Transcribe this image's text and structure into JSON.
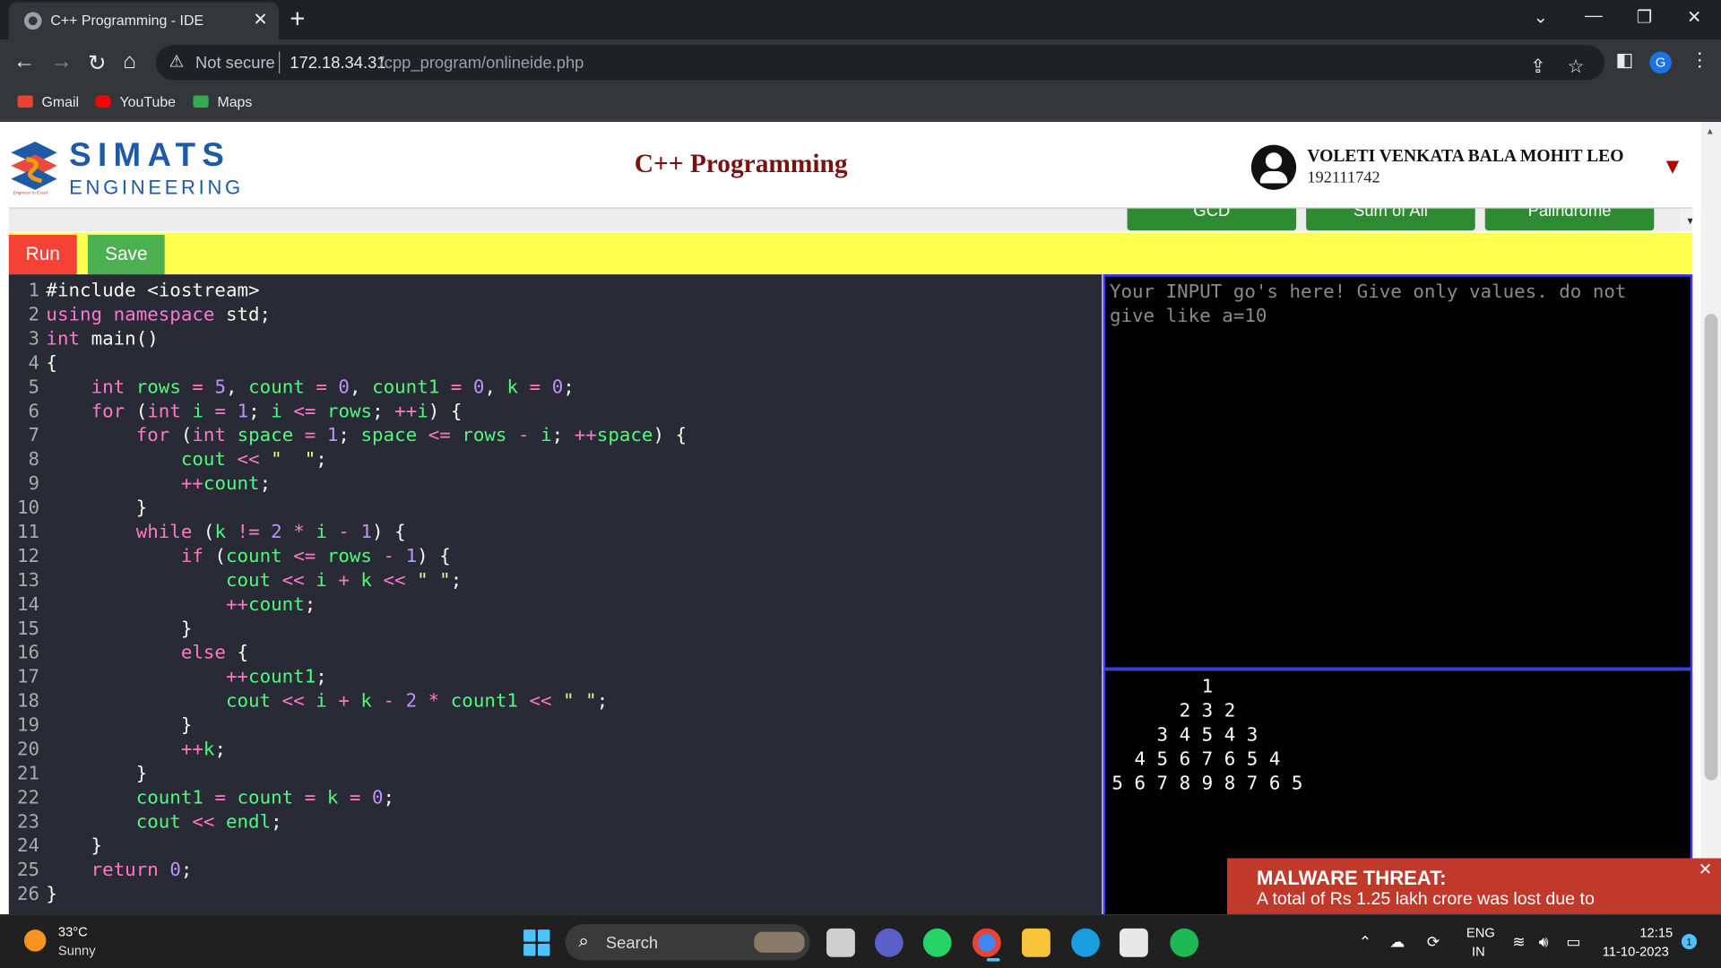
{
  "browser": {
    "tab_title": "C++ Programming - IDE",
    "tab_close": "✕",
    "new_tab": "+",
    "address": {
      "security_label": "Not secure",
      "url_host": "172.18.34.31",
      "url_path": "/cpp_program/onlineide.php"
    },
    "profile_initial": "G",
    "bookmarks": [
      {
        "label": "Gmail",
        "icon": "gmail-icon",
        "color": "#ea4335"
      },
      {
        "label": "YouTube",
        "icon": "youtube-icon",
        "color": "#ff0000"
      },
      {
        "label": "Maps",
        "icon": "maps-icon",
        "color": "#34a853"
      }
    ]
  },
  "header": {
    "logo_main": "SIMATS",
    "logo_sub": "ENGINEERING",
    "logo_tagline": "Engineer to Excel",
    "page_title": "C++ Programming",
    "user_name": "VOLETI VENKATA BALA MOHIT LEO",
    "user_id": "192111742"
  },
  "examples": [
    "GCD",
    "Sum of All",
    "Palindrome"
  ],
  "actions": {
    "run_label": "Run",
    "save_label": "Save"
  },
  "editor": {
    "lines": [
      {
        "n": "1",
        "tokens": [
          [
            "t",
            "#include <iostream>"
          ]
        ]
      },
      {
        "n": "2",
        "tokens": [
          [
            "kw",
            "using namespace"
          ],
          [
            "t",
            " std;"
          ]
        ]
      },
      {
        "n": "3",
        "tokens": [
          [
            "ty",
            "int"
          ],
          [
            "t",
            " main()"
          ]
        ]
      },
      {
        "n": "4",
        "tokens": [
          [
            "t",
            "{"
          ]
        ]
      },
      {
        "n": "5",
        "tokens": [
          [
            "t",
            "    "
          ],
          [
            "ty",
            "int"
          ],
          [
            "t",
            " "
          ],
          [
            "id",
            "rows"
          ],
          [
            "op",
            " = "
          ],
          [
            "num",
            "5"
          ],
          [
            "t",
            ", "
          ],
          [
            "id",
            "count"
          ],
          [
            "op",
            " = "
          ],
          [
            "num",
            "0"
          ],
          [
            "t",
            ", "
          ],
          [
            "id",
            "count1"
          ],
          [
            "op",
            " = "
          ],
          [
            "num",
            "0"
          ],
          [
            "t",
            ", "
          ],
          [
            "id",
            "k"
          ],
          [
            "op",
            " = "
          ],
          [
            "num",
            "0"
          ],
          [
            "t",
            ";"
          ]
        ]
      },
      {
        "n": "6",
        "tokens": [
          [
            "t",
            "    "
          ],
          [
            "kw",
            "for"
          ],
          [
            "t",
            " ("
          ],
          [
            "ty",
            "int"
          ],
          [
            "t",
            " "
          ],
          [
            "id",
            "i"
          ],
          [
            "op",
            " = "
          ],
          [
            "num",
            "1"
          ],
          [
            "t",
            "; "
          ],
          [
            "id",
            "i"
          ],
          [
            "op",
            " <= "
          ],
          [
            "id",
            "rows"
          ],
          [
            "t",
            "; "
          ],
          [
            "op",
            "++"
          ],
          [
            "id",
            "i"
          ],
          [
            "t",
            ") {"
          ]
        ]
      },
      {
        "n": "7",
        "tokens": [
          [
            "t",
            "        "
          ],
          [
            "kw",
            "for"
          ],
          [
            "t",
            " ("
          ],
          [
            "ty",
            "int"
          ],
          [
            "t",
            " "
          ],
          [
            "id",
            "space"
          ],
          [
            "op",
            " = "
          ],
          [
            "num",
            "1"
          ],
          [
            "t",
            "; "
          ],
          [
            "id",
            "space"
          ],
          [
            "op",
            " <= "
          ],
          [
            "id",
            "rows"
          ],
          [
            "op",
            " - "
          ],
          [
            "id",
            "i"
          ],
          [
            "t",
            "; "
          ],
          [
            "op",
            "++"
          ],
          [
            "id",
            "space"
          ],
          [
            "t",
            ") {"
          ]
        ]
      },
      {
        "n": "8",
        "tokens": [
          [
            "t",
            "            "
          ],
          [
            "id",
            "cout"
          ],
          [
            "op",
            " << "
          ],
          [
            "str",
            "\"  \""
          ],
          [
            "t",
            ";"
          ]
        ]
      },
      {
        "n": "9",
        "tokens": [
          [
            "t",
            "            "
          ],
          [
            "op",
            "++"
          ],
          [
            "id",
            "count"
          ],
          [
            "t",
            ";"
          ]
        ]
      },
      {
        "n": "10",
        "tokens": [
          [
            "t",
            "        }"
          ]
        ]
      },
      {
        "n": "11",
        "tokens": [
          [
            "t",
            "        "
          ],
          [
            "kw",
            "while"
          ],
          [
            "t",
            " ("
          ],
          [
            "id",
            "k"
          ],
          [
            "op",
            " != "
          ],
          [
            "num",
            "2"
          ],
          [
            "op",
            " * "
          ],
          [
            "id",
            "i"
          ],
          [
            "op",
            " - "
          ],
          [
            "num",
            "1"
          ],
          [
            "t",
            ") {"
          ]
        ]
      },
      {
        "n": "12",
        "tokens": [
          [
            "t",
            "            "
          ],
          [
            "kw",
            "if"
          ],
          [
            "t",
            " ("
          ],
          [
            "id",
            "count"
          ],
          [
            "op",
            " <= "
          ],
          [
            "id",
            "rows"
          ],
          [
            "op",
            " - "
          ],
          [
            "num",
            "1"
          ],
          [
            "t",
            ") {"
          ]
        ]
      },
      {
        "n": "13",
        "tokens": [
          [
            "t",
            "                "
          ],
          [
            "id",
            "cout"
          ],
          [
            "op",
            " << "
          ],
          [
            "id",
            "i"
          ],
          [
            "op",
            " + "
          ],
          [
            "id",
            "k"
          ],
          [
            "op",
            " << "
          ],
          [
            "str",
            "\" \""
          ],
          [
            "t",
            ";"
          ]
        ]
      },
      {
        "n": "14",
        "tokens": [
          [
            "t",
            "                "
          ],
          [
            "op",
            "++"
          ],
          [
            "id",
            "count"
          ],
          [
            "t",
            ";"
          ]
        ]
      },
      {
        "n": "15",
        "tokens": [
          [
            "t",
            "            }"
          ]
        ]
      },
      {
        "n": "16",
        "tokens": [
          [
            "t",
            "            "
          ],
          [
            "kw",
            "else"
          ],
          [
            "t",
            " {"
          ]
        ]
      },
      {
        "n": "17",
        "tokens": [
          [
            "t",
            "                "
          ],
          [
            "op",
            "++"
          ],
          [
            "id",
            "count1"
          ],
          [
            "t",
            ";"
          ]
        ]
      },
      {
        "n": "18",
        "tokens": [
          [
            "t",
            "                "
          ],
          [
            "id",
            "cout"
          ],
          [
            "op",
            " << "
          ],
          [
            "id",
            "i"
          ],
          [
            "op",
            " + "
          ],
          [
            "id",
            "k"
          ],
          [
            "op",
            " - "
          ],
          [
            "num",
            "2"
          ],
          [
            "op",
            " * "
          ],
          [
            "id",
            "count1"
          ],
          [
            "op",
            " << "
          ],
          [
            "str",
            "\" \""
          ],
          [
            "t",
            ";"
          ]
        ]
      },
      {
        "n": "19",
        "tokens": [
          [
            "t",
            "            }"
          ]
        ]
      },
      {
        "n": "20",
        "tokens": [
          [
            "t",
            "            "
          ],
          [
            "op",
            "++"
          ],
          [
            "id",
            "k"
          ],
          [
            "t",
            ";"
          ]
        ]
      },
      {
        "n": "21",
        "tokens": [
          [
            "t",
            "        }"
          ]
        ]
      },
      {
        "n": "22",
        "tokens": [
          [
            "t",
            "        "
          ],
          [
            "id",
            "count1"
          ],
          [
            "op",
            " = "
          ],
          [
            "id",
            "count"
          ],
          [
            "op",
            " = "
          ],
          [
            "id",
            "k"
          ],
          [
            "op",
            " = "
          ],
          [
            "num",
            "0"
          ],
          [
            "t",
            ";"
          ]
        ]
      },
      {
        "n": "23",
        "tokens": [
          [
            "t",
            "        "
          ],
          [
            "id",
            "cout"
          ],
          [
            "op",
            " << "
          ],
          [
            "id",
            "endl"
          ],
          [
            "t",
            ";"
          ]
        ]
      },
      {
        "n": "24",
        "tokens": [
          [
            "t",
            "    }"
          ]
        ]
      },
      {
        "n": "25",
        "tokens": [
          [
            "t",
            "    "
          ],
          [
            "kw",
            "return"
          ],
          [
            "t",
            " "
          ],
          [
            "num",
            "0"
          ],
          [
            "t",
            ";"
          ]
        ]
      },
      {
        "n": "26",
        "tokens": [
          [
            "t",
            "}"
          ]
        ]
      }
    ]
  },
  "input_pane": {
    "placeholder": "Your INPUT go's here! Give only values. do not give like a=10"
  },
  "output_pane": {
    "lines": [
      "        1",
      "      2 3 2",
      "    3 4 5 4 3",
      "  4 5 6 7 6 5 4",
      "5 6 7 8 9 8 7 6 5"
    ]
  },
  "toast": {
    "title": "MALWARE THREAT:",
    "body": "A total of Rs 1.25 lakh crore was lost due to",
    "close": "✕"
  },
  "taskbar": {
    "weather_temp": "33°C",
    "weather_cond": "Sunny",
    "search_label": "Search",
    "lang_line1": "ENG",
    "lang_line2": "IN",
    "time": "12:15",
    "date": "11-10-2023",
    "notifications": "1"
  }
}
